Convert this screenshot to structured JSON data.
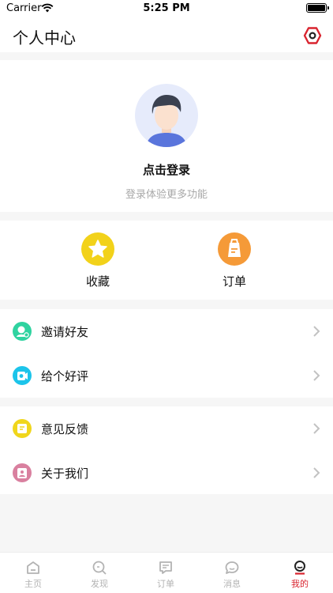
{
  "status_bar": {
    "carrier": "Carrier",
    "time": "5:25 PM"
  },
  "header": {
    "title": "个人中心",
    "settings_icon": "gear-icon"
  },
  "profile": {
    "login_title": "点击登录",
    "login_subtitle": "登录体验更多功能",
    "avatar_icon": "avatar-icon"
  },
  "shortcuts": [
    {
      "label": "收藏",
      "icon": "star-icon",
      "color": "#f2d21a"
    },
    {
      "label": "订单",
      "icon": "order-bag-icon",
      "color": "#f59a38"
    }
  ],
  "menu_group_1": [
    {
      "label": "邀请好友",
      "icon": "invite-icon",
      "color": "#2fd3a0"
    },
    {
      "label": "给个好评",
      "icon": "rate-icon",
      "color": "#1cc4ea"
    }
  ],
  "menu_group_2": [
    {
      "label": "意见反馈",
      "icon": "feedback-icon",
      "color": "#f0d61c"
    },
    {
      "label": "关于我们",
      "icon": "about-icon",
      "color": "#d9809f"
    }
  ],
  "tabbar": [
    {
      "label": "主页",
      "icon": "home-icon"
    },
    {
      "label": "发现",
      "icon": "discover-icon"
    },
    {
      "label": "订单",
      "icon": "order-icon"
    },
    {
      "label": "消息",
      "icon": "message-icon"
    },
    {
      "label": "我的",
      "icon": "profile-icon",
      "active": true
    }
  ],
  "colors": {
    "accent": "#d9242f",
    "background": "#f6f6f6"
  }
}
